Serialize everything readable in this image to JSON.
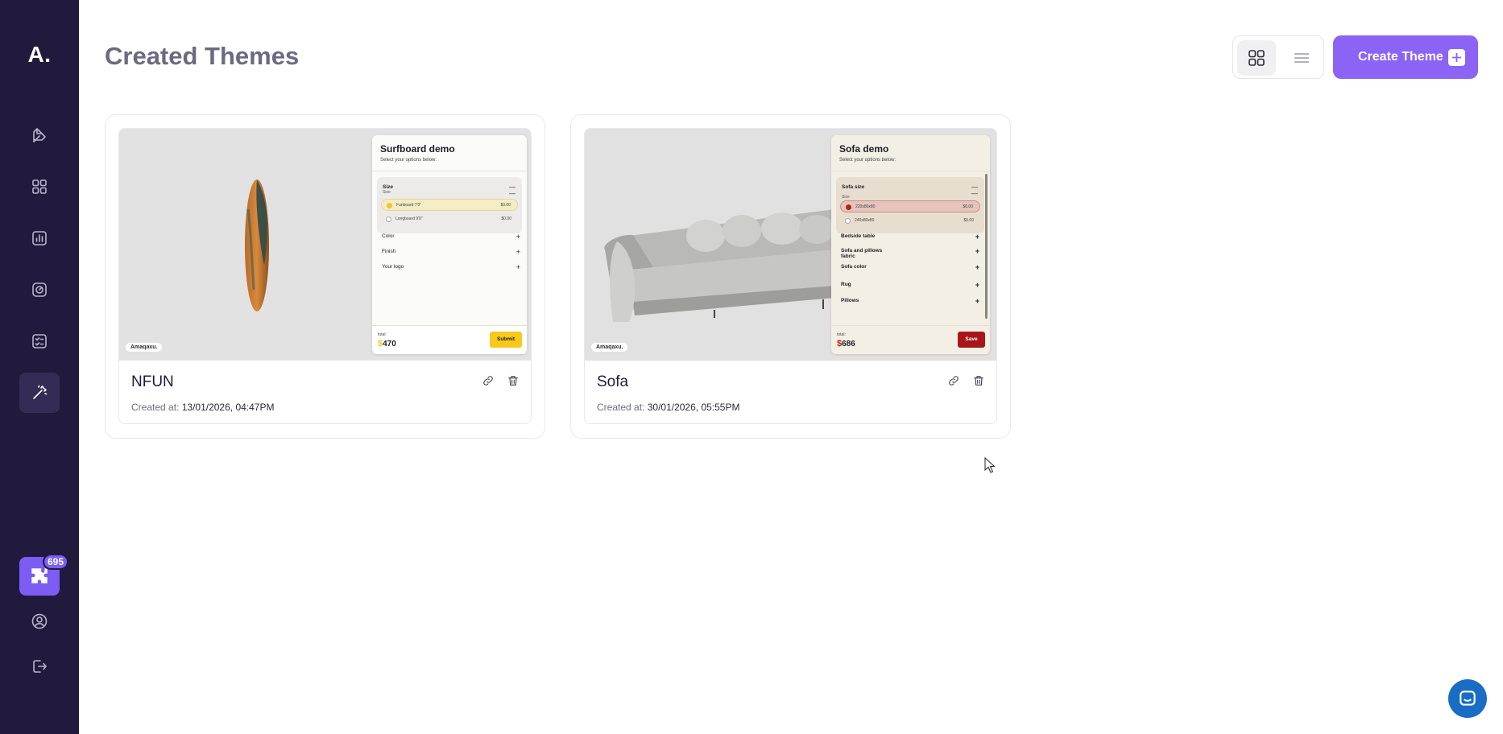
{
  "app": {
    "logo": "A.",
    "title": "Created Themes",
    "credits_count": "695"
  },
  "sidebar": {
    "items": [
      {
        "name": "themes-editor",
        "icon": "pen-palette-icon"
      },
      {
        "name": "dashboard",
        "icon": "grid-icon"
      },
      {
        "name": "analytics",
        "icon": "bar-chart-icon"
      },
      {
        "name": "integrations",
        "icon": "target-icon"
      },
      {
        "name": "tasks",
        "icon": "checklist-icon"
      },
      {
        "name": "magic",
        "icon": "magic-wand-icon",
        "active": true
      }
    ],
    "bottom": [
      {
        "name": "account",
        "icon": "user-circle-icon"
      },
      {
        "name": "logout",
        "icon": "logout-icon"
      }
    ]
  },
  "toolbar": {
    "create_label": "Create Theme",
    "views": [
      "grid",
      "list"
    ],
    "active_view": "grid"
  },
  "themes": [
    {
      "name": "NFUN",
      "created_label": "Created at:",
      "created_date": "13/01/2026, 04:47PM",
      "preview": {
        "brand": "Amaqaxu.",
        "panel_title": "Surfboard demo",
        "panel_sub": "Select your options below:",
        "option_group": "Size",
        "option_sub": "Size",
        "options": [
          {
            "label": "Funboard 7'0\"",
            "price": "$0.00",
            "selected": true
          },
          {
            "label": "Longboard 9'0\"",
            "price": "$0.00",
            "selected": false
          }
        ],
        "accordions": [
          "Color",
          "Finish",
          "Your logo"
        ],
        "total_label": "total:",
        "currency": "$",
        "total": "470",
        "button": "Submit"
      }
    },
    {
      "name": "Sofa",
      "created_label": "Created at:",
      "created_date": "30/01/2026, 05:55PM",
      "preview": {
        "brand": "Amaqaxu.",
        "panel_title": "Sofa demo",
        "panel_sub": "Select your options below:",
        "option_group": "Sofa size",
        "option_sub": "Size",
        "options": [
          {
            "label": "220x80x80",
            "price": "$0.00",
            "selected": true
          },
          {
            "label": "240x80x80",
            "price": "$0.00",
            "selected": false
          }
        ],
        "accordions": [
          "Bedside table",
          "Sofa and pillows fabric",
          "Sofa color",
          "Rug",
          "Pillows"
        ],
        "total_label": "total:",
        "currency": "$",
        "total": "686",
        "button": "Save"
      }
    }
  ],
  "colors": {
    "sidebar_bg": "#221a3d",
    "accent": "#8b63f5",
    "chat": "#1a6dc4"
  }
}
